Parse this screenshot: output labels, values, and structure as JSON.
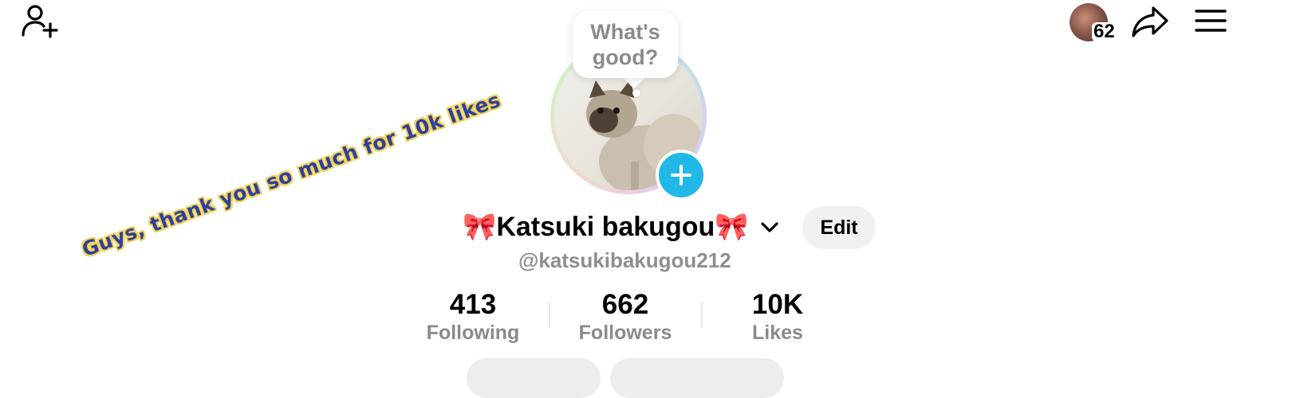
{
  "topbar": {
    "add_friend_icon": "add-person-icon",
    "friends_count": "62",
    "share_icon": "share-arrow-icon",
    "menu_icon": "hamburger-menu-icon"
  },
  "bubble": {
    "line1": "What's",
    "line2": "good?"
  },
  "sticker": {
    "text": "Guys, thank you so much for 10k likes"
  },
  "profile": {
    "display_name": "🎀Katsuki bakugou🎀",
    "handle": "@katsukibakugou212",
    "edit_label": "Edit"
  },
  "stats": [
    {
      "value": "413",
      "label": "Following"
    },
    {
      "value": "662",
      "label": "Followers"
    },
    {
      "value": "10K",
      "label": "Likes"
    }
  ],
  "colors": {
    "accent_blue": "#21b8e8",
    "sticker_fill": "#2f3f9e",
    "sticker_outline": "#f0d35a",
    "muted_text": "#8a8a8a"
  }
}
